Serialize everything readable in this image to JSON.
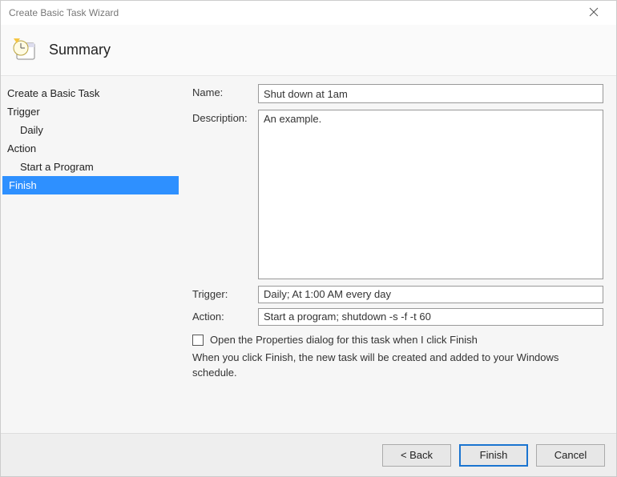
{
  "window": {
    "title": "Create Basic Task Wizard"
  },
  "header": {
    "title": "Summary"
  },
  "sidebar": {
    "items": [
      {
        "label": "Create a Basic Task"
      },
      {
        "label": "Trigger"
      },
      {
        "label": "Daily"
      },
      {
        "label": "Action"
      },
      {
        "label": "Start a Program"
      },
      {
        "label": "Finish"
      }
    ]
  },
  "form": {
    "name_label": "Name:",
    "name_value": "Shut down at 1am",
    "description_label": "Description:",
    "description_value": "An example.",
    "trigger_label": "Trigger:",
    "trigger_value": "Daily; At 1:00 AM every day",
    "action_label": "Action:",
    "action_value": "Start a program; shutdown -s -f -t 60",
    "checkbox_label": "Open the Properties dialog for this task when I click Finish",
    "checkbox_checked": false,
    "info_text": "When you click Finish, the new task will be created and added to your Windows schedule."
  },
  "footer": {
    "back_label": "< Back",
    "finish_label": "Finish",
    "cancel_label": "Cancel"
  }
}
